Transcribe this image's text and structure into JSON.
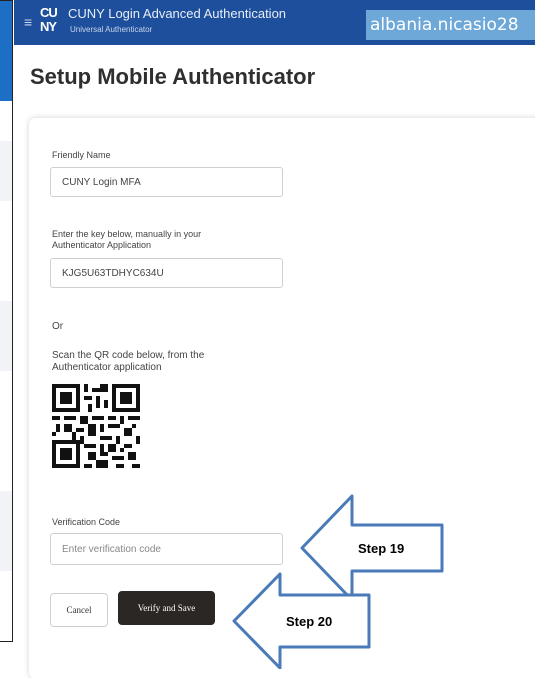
{
  "header": {
    "logo_top": "CU",
    "logo_bottom": "NY",
    "app_title": "CUNY Login Advanced Authentication",
    "app_subtitle": "Universal Authenticator",
    "username": "albania.nicasio28"
  },
  "page_title": "Setup Mobile Authenticator",
  "form": {
    "friendly_name_label": "Friendly Name",
    "friendly_name_value": "CUNY Login MFA",
    "key_label_line1": "Enter the key below, manually in your",
    "key_label_line2": "Authenticator Application",
    "key_value": "KJG5U63TDHYC634U",
    "or_text": "Or",
    "qr_label_line1": "Scan the QR code below, from the",
    "qr_label_line2": "Authenticator application",
    "verification_label": "Verification Code",
    "verification_placeholder": "Enter verification code",
    "cancel_label": "Cancel",
    "verify_label": "Verify and Save"
  },
  "annotations": {
    "step19": "Step 19",
    "step20": "Step 20"
  },
  "colors": {
    "header_bg": "#1d4f9c",
    "user_box_bg": "#6ea8d8",
    "verify_button_bg": "#2b2725",
    "arrow_stroke": "#4a7ab8",
    "arrow_fill": "#ffffff"
  },
  "icons": {
    "menu": "hamburger-icon",
    "qr": "qr-code"
  }
}
